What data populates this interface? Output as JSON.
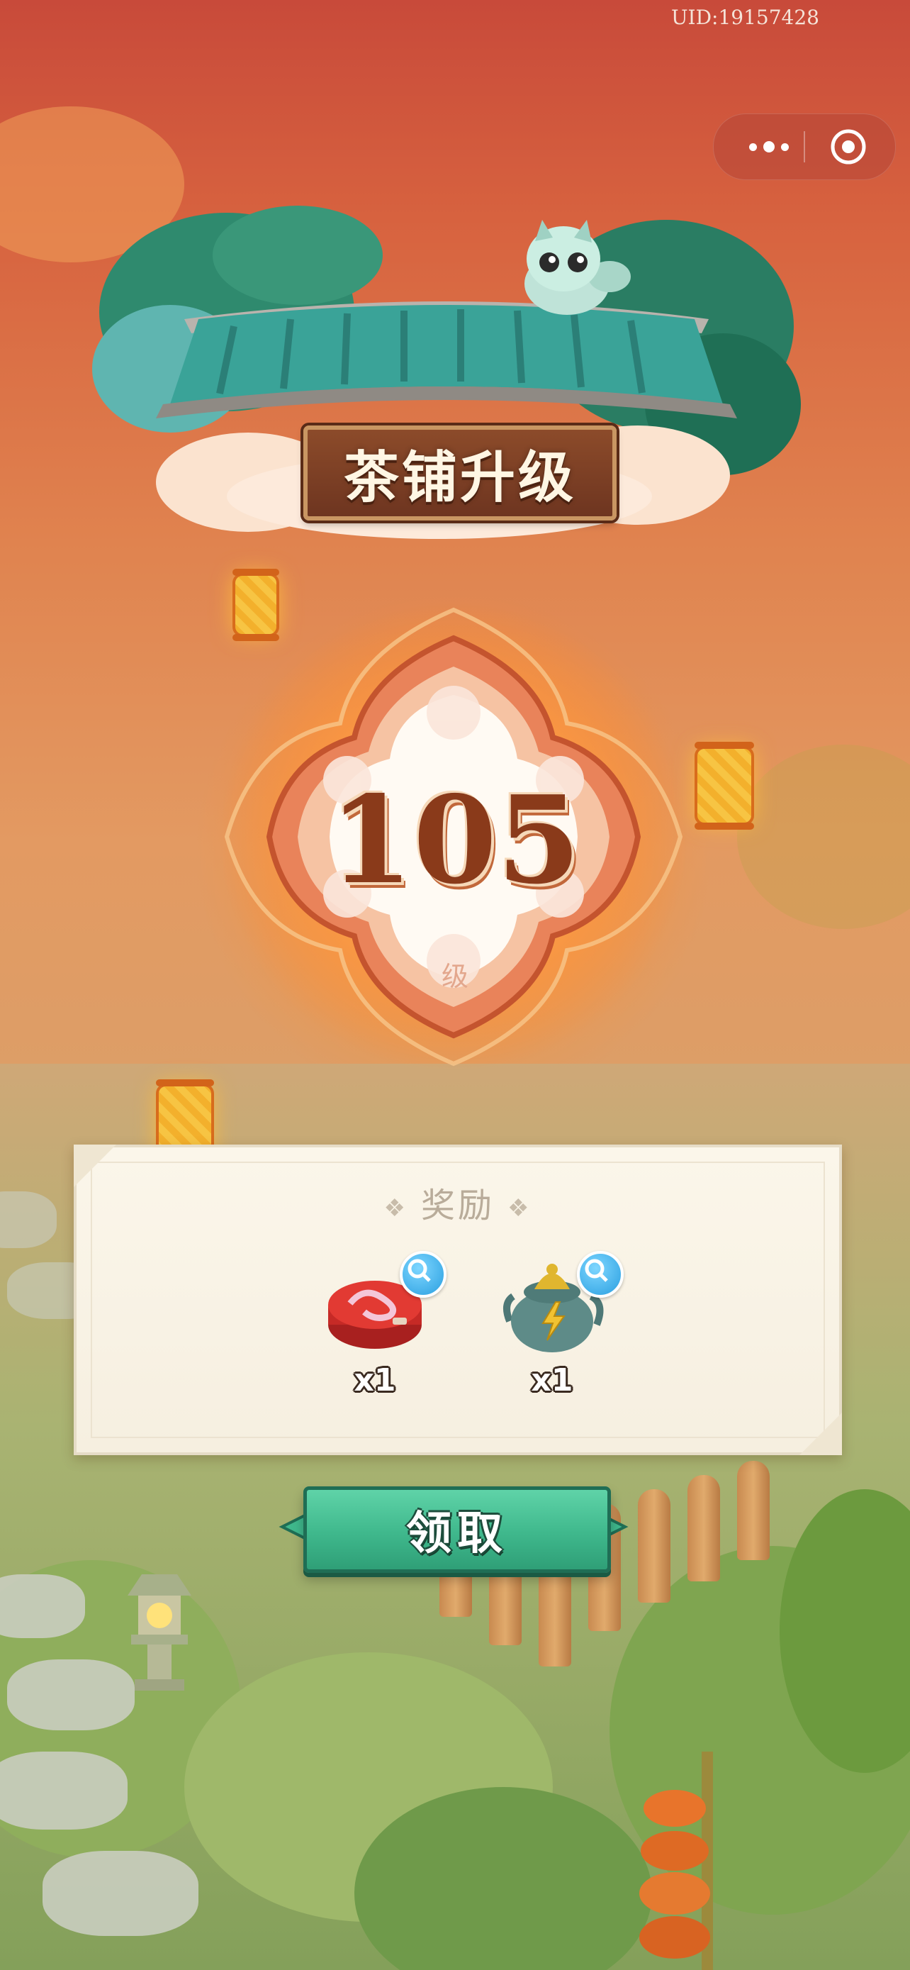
{
  "status": {
    "uid": "UID:19157428"
  },
  "mini_program_capsule": {
    "more_icon": "more-dots-icon",
    "close_icon": "target-circle-icon"
  },
  "banner": {
    "title": "茶铺升级"
  },
  "level": {
    "value": "105",
    "unit": "级"
  },
  "reward": {
    "title": "奖励",
    "items": [
      {
        "icon": "red-tin-box-icon",
        "count": "x1"
      },
      {
        "icon": "teapot-lightning-icon",
        "count": "x1"
      }
    ]
  },
  "claim_button": {
    "label": "领取"
  },
  "colors": {
    "accent_green": "#3fb88c",
    "title_brown": "#8a3a1a",
    "panel_bg": "#fbf6ea",
    "top_red": "#c84a3a"
  }
}
